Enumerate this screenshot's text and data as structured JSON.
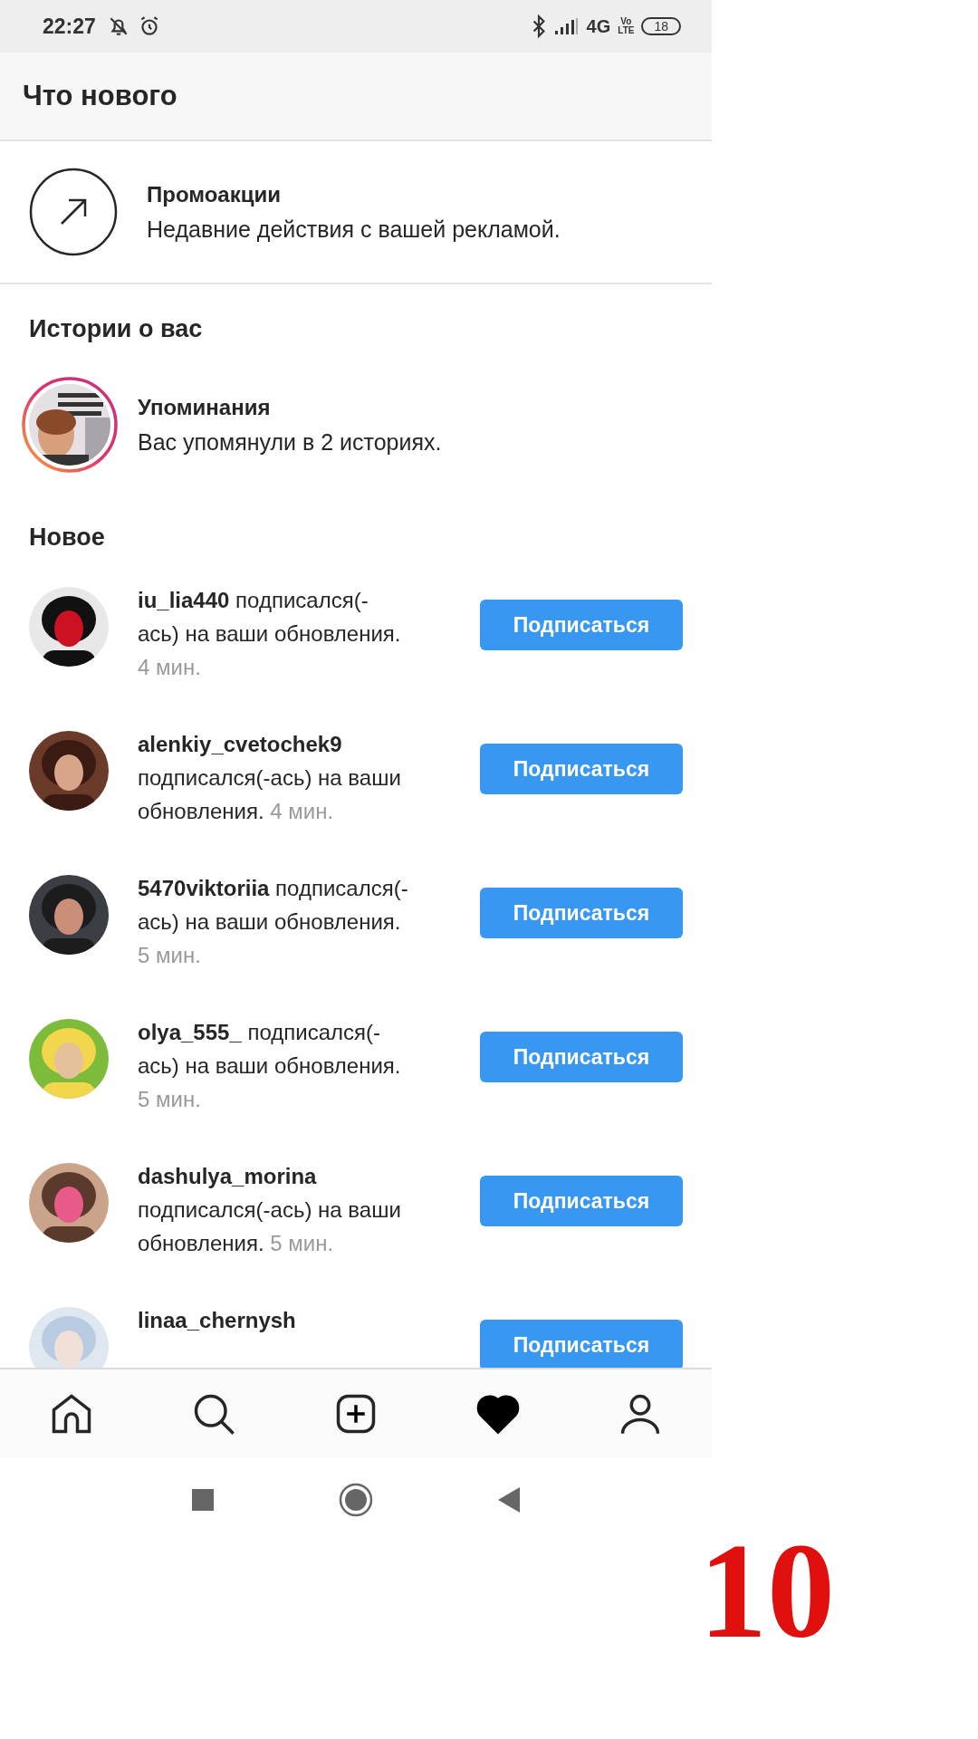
{
  "status_bar": {
    "time": "22:27",
    "network": "4G",
    "volte_top": "Vo",
    "volte_bottom": "LTE",
    "battery": "18"
  },
  "header": {
    "title": "Что нового"
  },
  "promo": {
    "title": "Промоакции",
    "subtitle": "Недавние действия с вашей рекламой."
  },
  "stories_section": {
    "title": "Истории о вас",
    "item": {
      "title": "Упоминания",
      "subtitle": "Вас упомянули в 2 историях."
    }
  },
  "new_section": {
    "title": "Новое",
    "notifications": [
      {
        "text": "**iu_lia440** подписался(-ась) на ваши обновления.",
        "time": "4 мин.",
        "button": "Подписаться"
      },
      {
        "text": "**alenkiy_cvetochek9** подписался(-ась) на ваши обновления.",
        "time": "4 мин.",
        "button": "Подписаться"
      },
      {
        "text": "**5470viktoriia** подписался(-ась) на ваши обновления.",
        "time": "5 мин.",
        "button": "Подписаться"
      },
      {
        "text": "**olya_555_** подписался(-ась) на ваши обновления.",
        "time": "5 мин.",
        "button": "Подписаться"
      },
      {
        "text": "**dashulya_morina** подписался(-ась) на ваши обновления.",
        "time": "5 мин.",
        "button": "Подписаться"
      },
      {
        "text": "**linaa_chernysh**",
        "button": "Подписаться"
      }
    ]
  },
  "tab_bar": [
    {
      "kind": "home",
      "selected": false
    },
    {
      "kind": "search",
      "selected": false
    },
    {
      "kind": "add",
      "selected": false
    },
    {
      "kind": "activity",
      "selected": true
    },
    {
      "kind": "profile",
      "selected": false
    }
  ],
  "step_number": "10"
}
